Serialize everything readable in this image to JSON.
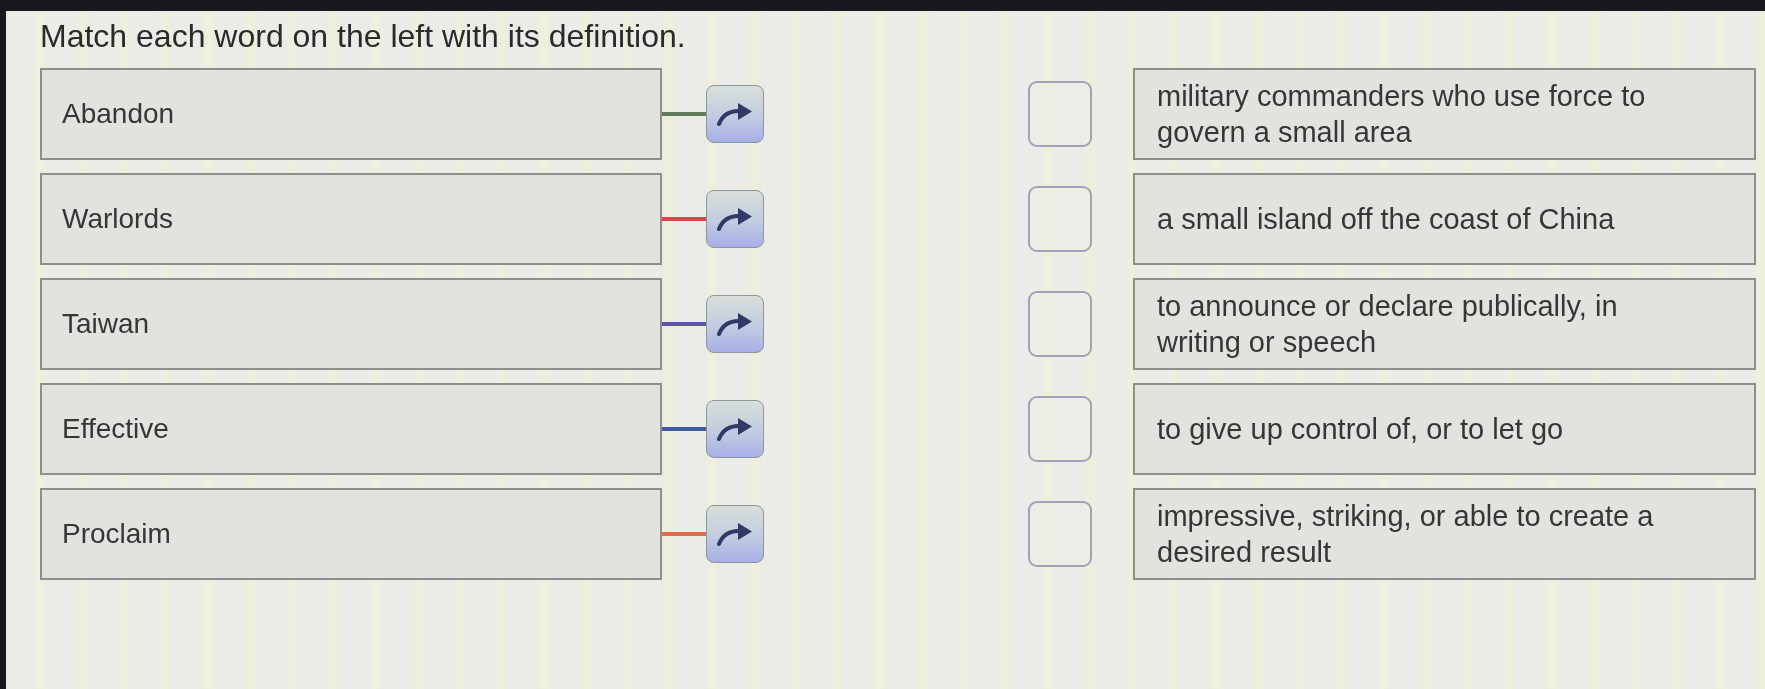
{
  "instruction": "Match each word on the left with its definition.",
  "words": [
    {
      "text": "Abandon",
      "color": "#627a5c"
    },
    {
      "text": "Warlords",
      "color": "#e0424a"
    },
    {
      "text": "Taiwan",
      "color": "#5a55a8"
    },
    {
      "text": "Effective",
      "color": "#3f5a9e"
    },
    {
      "text": "Proclaim",
      "color": "#e8694c"
    }
  ],
  "definitions": [
    {
      "text": "military commanders who use force to govern a small area"
    },
    {
      "text": "a small island off the coast of China"
    },
    {
      "text": "to announce or declare publically, in writing or speech"
    },
    {
      "text": "to give up control of, or to let go"
    },
    {
      "text": "impressive, striking, or able to create a desired result"
    }
  ]
}
